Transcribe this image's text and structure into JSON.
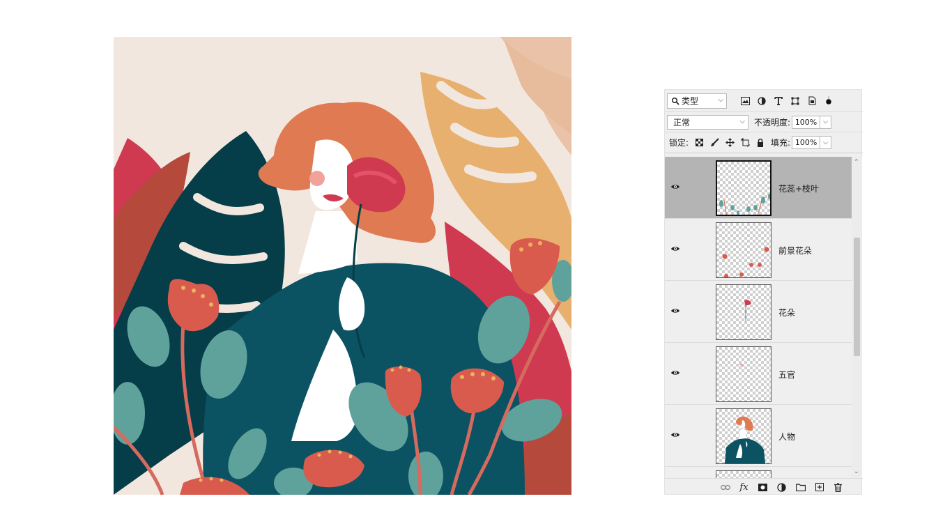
{
  "layers_panel": {
    "filter_label": "类型",
    "blend_mode": "正常",
    "opacity_label": "不透明度:",
    "opacity_value": "100%",
    "lock_label": "锁定:",
    "fill_label": "填充:",
    "fill_value": "100%",
    "layers": [
      {
        "name": "花蕊+枝叶",
        "visible": true,
        "selected": true
      },
      {
        "name": "前景花朵",
        "visible": true,
        "selected": false
      },
      {
        "name": "花朵",
        "visible": true,
        "selected": false
      },
      {
        "name": "五官",
        "visible": true,
        "selected": false
      },
      {
        "name": "人物",
        "visible": true,
        "selected": false
      }
    ]
  },
  "icons": {
    "filter": [
      "search-icon",
      "image-filter-icon",
      "adjustment-filter-icon",
      "type-filter-icon",
      "shape-filter-icon",
      "smart-object-filter-icon",
      "filter-toggle-icon"
    ],
    "lock": [
      "lock-transparent-icon",
      "lock-brush-icon",
      "lock-move-icon",
      "lock-artboard-icon",
      "lock-all-icon"
    ],
    "bottom": [
      "link-layers-icon",
      "fx-icon",
      "mask-icon",
      "adjustment-layer-icon",
      "group-folder-icon",
      "new-layer-icon",
      "trash-icon"
    ]
  },
  "colors": {
    "canvas_bg": "#f2e7de",
    "hair": "#e07a52",
    "teal_dark": "#0b5262",
    "teal_darker": "#053d48",
    "crimson": "#cf3a50",
    "coral": "#d95b4e",
    "leaf_green": "#5fa29c",
    "mustard": "#e8b06f",
    "peach": "#e9c2a7",
    "skin": "#ffffff"
  }
}
